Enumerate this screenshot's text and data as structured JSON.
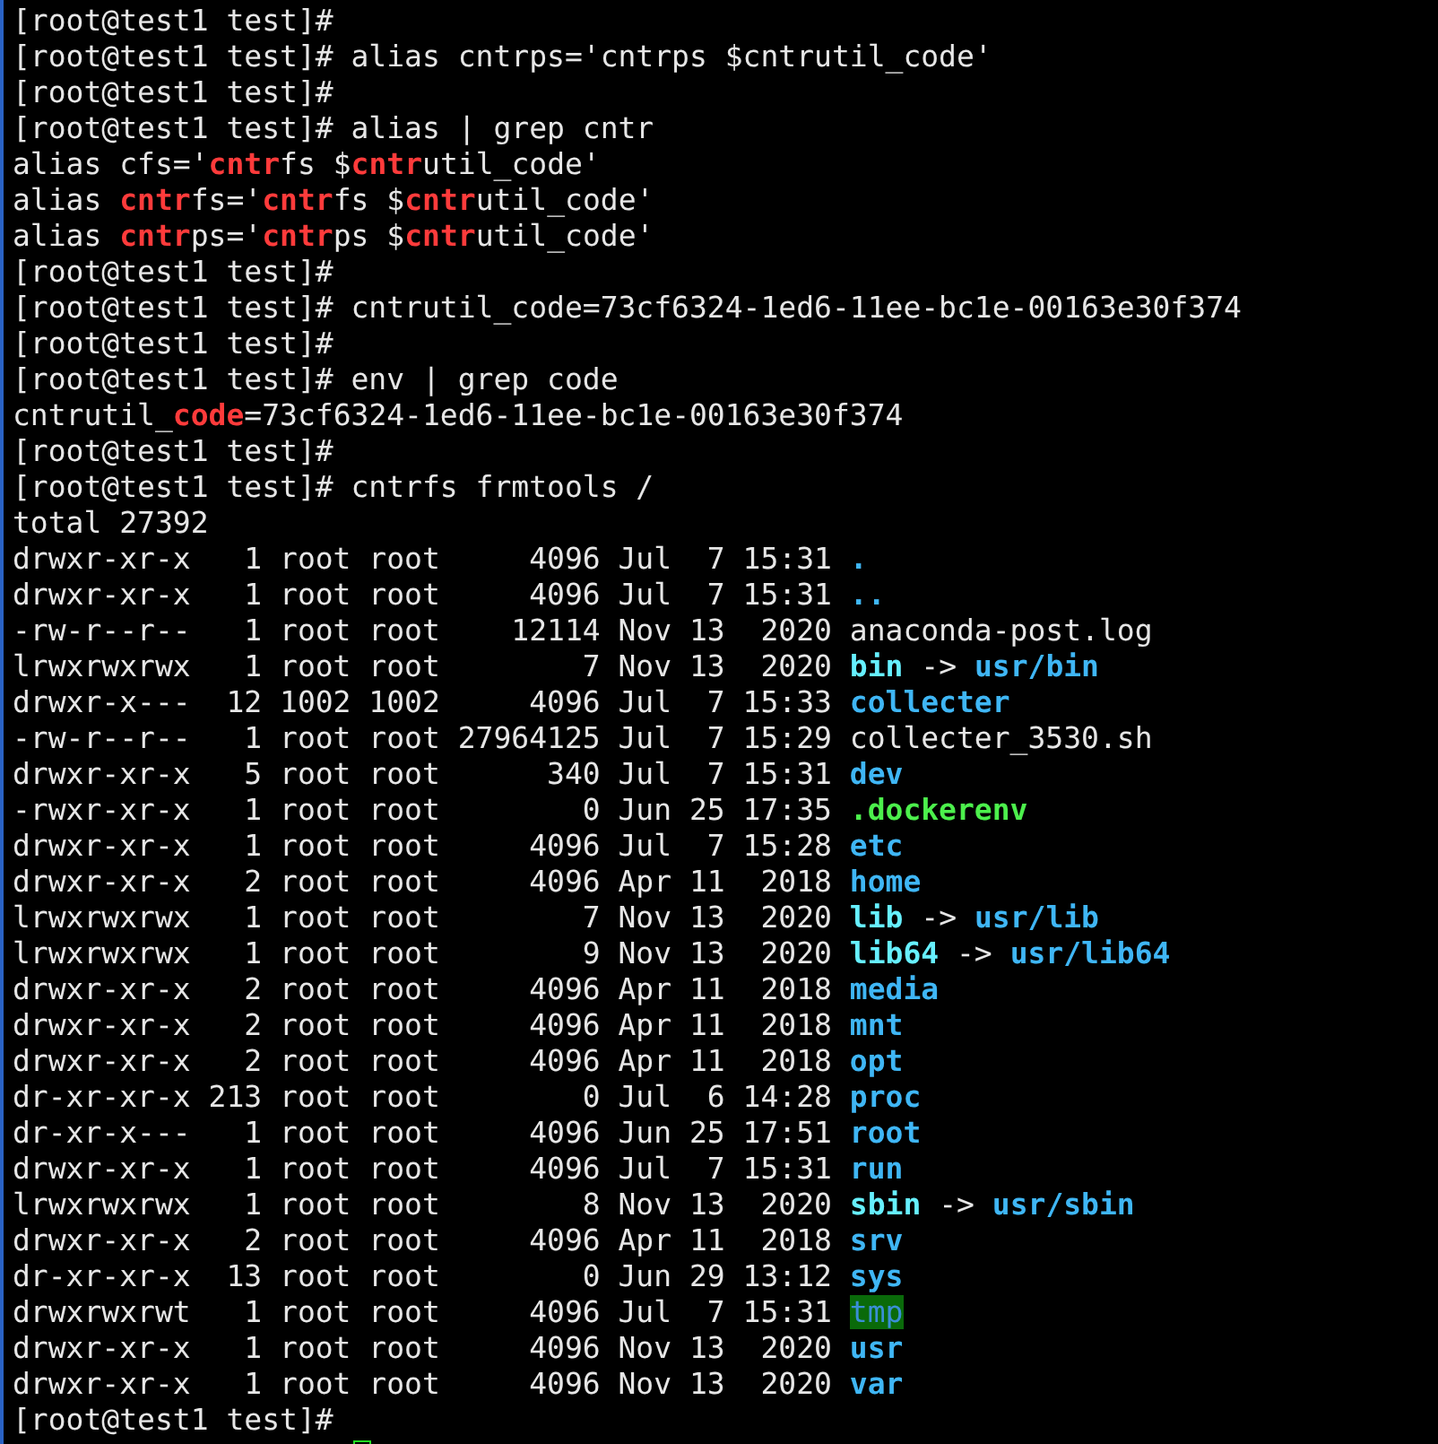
{
  "terminal": {
    "lines": [
      [
        {
          "text": "[root@test1 test]#",
          "kind": "plain"
        }
      ],
      [
        {
          "text": "[root@test1 test]# alias cntrps='cntrps $cntrutil_code'",
          "kind": "plain"
        }
      ],
      [
        {
          "text": "[root@test1 test]#",
          "kind": "plain"
        }
      ],
      [
        {
          "text": "[root@test1 test]# alias | grep cntr",
          "kind": "plain"
        }
      ],
      [
        {
          "text": "alias cfs='",
          "kind": "plain"
        },
        {
          "text": "cntr",
          "kind": "match"
        },
        {
          "text": "fs $",
          "kind": "plain"
        },
        {
          "text": "cntr",
          "kind": "match"
        },
        {
          "text": "util_code'",
          "kind": "plain"
        }
      ],
      [
        {
          "text": "alias ",
          "kind": "plain"
        },
        {
          "text": "cntr",
          "kind": "match"
        },
        {
          "text": "fs='",
          "kind": "plain"
        },
        {
          "text": "cntr",
          "kind": "match"
        },
        {
          "text": "fs $",
          "kind": "plain"
        },
        {
          "text": "cntr",
          "kind": "match"
        },
        {
          "text": "util_code'",
          "kind": "plain"
        }
      ],
      [
        {
          "text": "alias ",
          "kind": "plain"
        },
        {
          "text": "cntr",
          "kind": "match"
        },
        {
          "text": "ps='",
          "kind": "plain"
        },
        {
          "text": "cntr",
          "kind": "match"
        },
        {
          "text": "ps $",
          "kind": "plain"
        },
        {
          "text": "cntr",
          "kind": "match"
        },
        {
          "text": "util_code'",
          "kind": "plain"
        }
      ],
      [
        {
          "text": "[root@test1 test]#",
          "kind": "plain"
        }
      ],
      [
        {
          "text": "[root@test1 test]# cntrutil_code=73cf6324-1ed6-11ee-bc1e-00163e30f374",
          "kind": "plain"
        }
      ],
      [
        {
          "text": "[root@test1 test]#",
          "kind": "plain"
        }
      ],
      [
        {
          "text": "[root@test1 test]# env | grep code",
          "kind": "plain"
        }
      ],
      [
        {
          "text": "cntrutil_",
          "kind": "plain"
        },
        {
          "text": "code",
          "kind": "match"
        },
        {
          "text": "=73cf6324-1ed6-11ee-bc1e-00163e30f374",
          "kind": "plain"
        }
      ],
      [
        {
          "text": "[root@test1 test]#",
          "kind": "plain"
        }
      ],
      [
        {
          "text": "[root@test1 test]# cntrfs frmtools /",
          "kind": "plain"
        }
      ],
      [
        {
          "text": "total 27392",
          "kind": "plain"
        }
      ],
      [
        {
          "text": "drwxr-xr-x   1 root root     4096 Jul  7 15:31 ",
          "kind": "plain"
        },
        {
          "text": ".",
          "kind": "dir"
        }
      ],
      [
        {
          "text": "drwxr-xr-x   1 root root     4096 Jul  7 15:31 ",
          "kind": "plain"
        },
        {
          "text": "..",
          "kind": "dir"
        }
      ],
      [
        {
          "text": "-rw-r--r--   1 root root    12114 Nov 13  2020 anaconda-post.log",
          "kind": "plain"
        }
      ],
      [
        {
          "text": "lrwxrwxrwx   1 root root        7 Nov 13  2020 ",
          "kind": "plain"
        },
        {
          "text": "bin",
          "kind": "link"
        },
        {
          "text": " -> ",
          "kind": "plain"
        },
        {
          "text": "usr/bin",
          "kind": "dir"
        }
      ],
      [
        {
          "text": "drwxr-x---  12 1002 1002     4096 Jul  7 15:33 ",
          "kind": "plain"
        },
        {
          "text": "collecter",
          "kind": "dir"
        }
      ],
      [
        {
          "text": "-rw-r--r--   1 root root 27964125 Jul  7 15:29 collecter_3530.sh",
          "kind": "plain"
        }
      ],
      [
        {
          "text": "drwxr-xr-x   5 root root      340 Jul  7 15:31 ",
          "kind": "plain"
        },
        {
          "text": "dev",
          "kind": "dir"
        }
      ],
      [
        {
          "text": "-rwxr-xr-x   1 root root        0 Jun 25 17:35 ",
          "kind": "plain"
        },
        {
          "text": ".dockerenv",
          "kind": "exec"
        }
      ],
      [
        {
          "text": "drwxr-xr-x   1 root root     4096 Jul  7 15:28 ",
          "kind": "plain"
        },
        {
          "text": "etc",
          "kind": "dir"
        }
      ],
      [
        {
          "text": "drwxr-xr-x   2 root root     4096 Apr 11  2018 ",
          "kind": "plain"
        },
        {
          "text": "home",
          "kind": "dir"
        }
      ],
      [
        {
          "text": "lrwxrwxrwx   1 root root        7 Nov 13  2020 ",
          "kind": "plain"
        },
        {
          "text": "lib",
          "kind": "link"
        },
        {
          "text": " -> ",
          "kind": "plain"
        },
        {
          "text": "usr/lib",
          "kind": "dir"
        }
      ],
      [
        {
          "text": "lrwxrwxrwx   1 root root        9 Nov 13  2020 ",
          "kind": "plain"
        },
        {
          "text": "lib64",
          "kind": "link"
        },
        {
          "text": " -> ",
          "kind": "plain"
        },
        {
          "text": "usr/lib64",
          "kind": "dir"
        }
      ],
      [
        {
          "text": "drwxr-xr-x   2 root root     4096 Apr 11  2018 ",
          "kind": "plain"
        },
        {
          "text": "media",
          "kind": "dir"
        }
      ],
      [
        {
          "text": "drwxr-xr-x   2 root root     4096 Apr 11  2018 ",
          "kind": "plain"
        },
        {
          "text": "mnt",
          "kind": "dir"
        }
      ],
      [
        {
          "text": "drwxr-xr-x   2 root root     4096 Apr 11  2018 ",
          "kind": "plain"
        },
        {
          "text": "opt",
          "kind": "dir"
        }
      ],
      [
        {
          "text": "dr-xr-xr-x 213 root root        0 Jul  6 14:28 ",
          "kind": "plain"
        },
        {
          "text": "proc",
          "kind": "dir"
        }
      ],
      [
        {
          "text": "dr-xr-x---   1 root root     4096 Jun 25 17:51 ",
          "kind": "plain"
        },
        {
          "text": "root",
          "kind": "dir"
        }
      ],
      [
        {
          "text": "drwxr-xr-x   1 root root     4096 Jul  7 15:31 ",
          "kind": "plain"
        },
        {
          "text": "run",
          "kind": "dir"
        }
      ],
      [
        {
          "text": "lrwxrwxrwx   1 root root        8 Nov 13  2020 ",
          "kind": "plain"
        },
        {
          "text": "sbin",
          "kind": "link"
        },
        {
          "text": " -> ",
          "kind": "plain"
        },
        {
          "text": "usr/sbin",
          "kind": "dir"
        }
      ],
      [
        {
          "text": "drwxr-xr-x   2 root root     4096 Apr 11  2018 ",
          "kind": "plain"
        },
        {
          "text": "srv",
          "kind": "dir"
        }
      ],
      [
        {
          "text": "dr-xr-xr-x  13 root root        0 Jun 29 13:12 ",
          "kind": "plain"
        },
        {
          "text": "sys",
          "kind": "dir"
        }
      ],
      [
        {
          "text": "drwxrwxrwt   1 root root     4096 Jul  7 15:31 ",
          "kind": "plain"
        },
        {
          "text": "tmp",
          "kind": "sticky"
        }
      ],
      [
        {
          "text": "drwxr-xr-x   1 root root     4096 Nov 13  2020 ",
          "kind": "plain"
        },
        {
          "text": "usr",
          "kind": "dir"
        }
      ],
      [
        {
          "text": "drwxr-xr-x   1 root root     4096 Nov 13  2020 ",
          "kind": "plain"
        },
        {
          "text": "var",
          "kind": "dir"
        }
      ],
      [
        {
          "text": "[root@test1 test]#",
          "kind": "plain"
        }
      ]
    ],
    "cursor": {
      "visible": true
    }
  }
}
